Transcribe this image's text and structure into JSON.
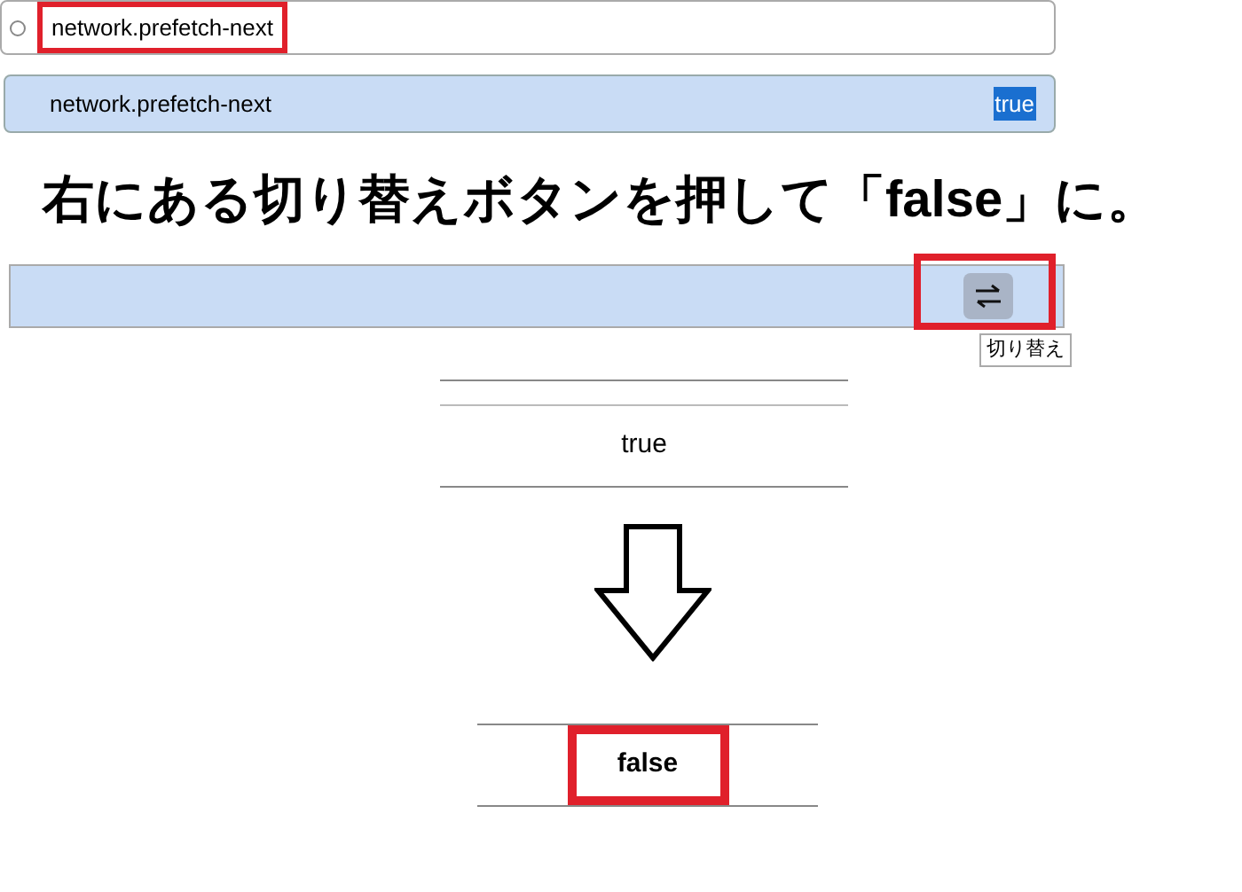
{
  "search": {
    "value": "network.prefetch-next",
    "highlighted": true
  },
  "pref_row": {
    "name": "network.prefetch-next",
    "value": "true",
    "value_selected": true
  },
  "instruction": "右にある切り替えボタンを押して「false」に。",
  "toggle_row": {
    "button_highlighted": true,
    "tooltip": "切り替え"
  },
  "before": {
    "value": "true"
  },
  "after": {
    "value": "false",
    "highlighted": true
  }
}
